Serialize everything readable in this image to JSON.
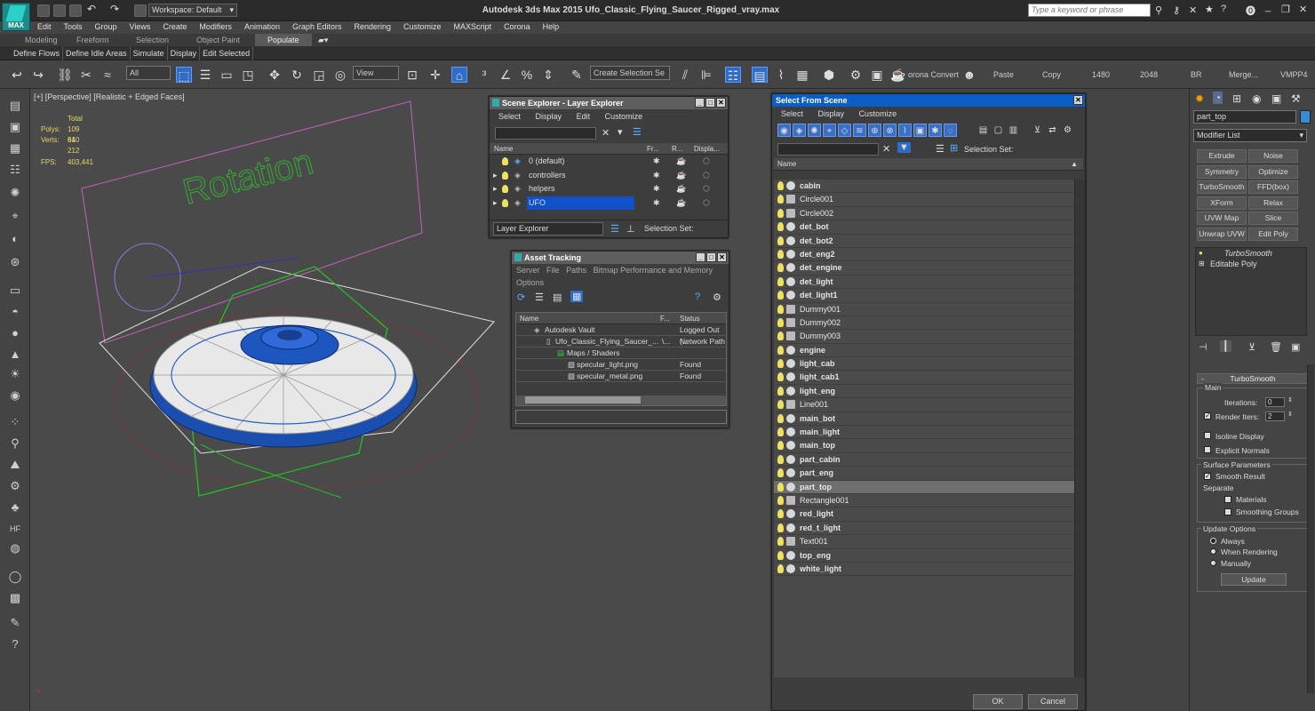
{
  "titlebar": {
    "logo_text": "MAX",
    "workspace_label": "Workspace: Default",
    "app_title": "Autodesk 3ds Max  2015    Ufo_Classic_Flying_Saucer_Rigged_vray.max",
    "search_placeholder": "Type a keyword or phrase"
  },
  "menus": [
    "Edit",
    "Tools",
    "Group",
    "Views",
    "Create",
    "Modifiers",
    "Animation",
    "Graph Editors",
    "Rendering",
    "Customize",
    "MAXScript",
    "Corona",
    "Help"
  ],
  "ribbon": {
    "tabs": [
      "Modeling",
      "Freeform",
      "Selection",
      "Object Paint",
      "Populate"
    ],
    "active_tab": "Populate",
    "sub_items": [
      "Define Flows",
      "Define Idle Areas",
      "Simulate",
      "Display",
      "Edit Selected"
    ]
  },
  "toolbar": {
    "filter_value": "All",
    "refcoord_value": "View",
    "selection_set_placeholder": "Create Selection Se",
    "corona_label": "orona Convert",
    "paste_label": "Paste",
    "copy_label": "Copy",
    "width_value": "1480",
    "height_value": "2048",
    "br_label": "BR",
    "merge_label": "Merge...",
    "vmpp_label": "VMPP4"
  },
  "viewport": {
    "label": "[+] [Perspective] [Realistic + Edged Faces]",
    "stats": {
      "total_label": "Total",
      "polys_label": "Polys:",
      "polys_value": "109 840",
      "verts_label": "Verts:",
      "verts_value": "61 212",
      "fps_label": "FPS:",
      "fps_value": "403,441"
    },
    "rotation_text": "Rotation",
    "accent_green": "#22c022",
    "accent_blue": "#1a5fd0"
  },
  "scene_explorer": {
    "title": "Scene Explorer - Layer Explorer",
    "menus": [
      "Select",
      "Display",
      "Edit",
      "Customize"
    ],
    "columns": [
      "Name",
      "Fr...",
      "R...",
      "Displa..."
    ],
    "rows": [
      {
        "name": "0 (default)",
        "expandable": false
      },
      {
        "name": "controllers",
        "expandable": true
      },
      {
        "name": "helpers",
        "expandable": true
      },
      {
        "name": "UFO",
        "expandable": true
      }
    ],
    "footer_dropdown": "Layer Explorer",
    "selection_set_label": "Selection Set:"
  },
  "asset_tracking": {
    "title": "Asset Tracking",
    "menus": [
      "Server",
      "File",
      "Paths",
      "Bitmap Performance and Memory"
    ],
    "menu_options": "Options",
    "columns": [
      "Name",
      "F...",
      "Status"
    ],
    "rows": [
      {
        "name": "Autodesk Vault",
        "f": "",
        "status": "Logged Out (..."
      },
      {
        "name": "Ufo_Classic_Flying_Saucer_...",
        "f": "\\...",
        "status": "Network Path"
      },
      {
        "name": "Maps / Shaders",
        "f": "",
        "status": ""
      },
      {
        "name": "specular_light.png",
        "f": "",
        "status": "Found"
      },
      {
        "name": "specular_metal.png",
        "f": "",
        "status": "Found"
      }
    ]
  },
  "select_from_scene": {
    "title": "Select From Scene",
    "menus": [
      "Select",
      "Display",
      "Customize"
    ],
    "selection_set_label": "Selection Set:",
    "column_name": "Name",
    "items": [
      {
        "name": "cabin",
        "bold": true
      },
      {
        "name": "Circle001",
        "bold": false
      },
      {
        "name": "Circle002",
        "bold": false
      },
      {
        "name": "det_bot",
        "bold": true
      },
      {
        "name": "det_bot2",
        "bold": true
      },
      {
        "name": "det_eng2",
        "bold": true
      },
      {
        "name": "det_engine",
        "bold": true
      },
      {
        "name": "det_light",
        "bold": true
      },
      {
        "name": "det_light1",
        "bold": true
      },
      {
        "name": "Dummy001",
        "bold": false
      },
      {
        "name": "Dummy002",
        "bold": false
      },
      {
        "name": "Dummy003",
        "bold": false
      },
      {
        "name": "engine",
        "bold": true
      },
      {
        "name": "light_cab",
        "bold": true
      },
      {
        "name": "light_cab1",
        "bold": true
      },
      {
        "name": "light_eng",
        "bold": true
      },
      {
        "name": "Line001",
        "bold": false
      },
      {
        "name": "main_bot",
        "bold": true
      },
      {
        "name": "main_light",
        "bold": true
      },
      {
        "name": "main_top",
        "bold": true
      },
      {
        "name": "part_cabin",
        "bold": true
      },
      {
        "name": "part_eng",
        "bold": true
      },
      {
        "name": "part_top",
        "bold": true,
        "selected": true
      },
      {
        "name": "Rectangle001",
        "bold": false
      },
      {
        "name": "red_light",
        "bold": true
      },
      {
        "name": "red_t_light",
        "bold": true
      },
      {
        "name": "Text001",
        "bold": false
      },
      {
        "name": "top_eng",
        "bold": true
      },
      {
        "name": "white_light",
        "bold": true
      }
    ],
    "ok_label": "OK",
    "cancel_label": "Cancel"
  },
  "command_panel": {
    "object_name": "part_top",
    "object_color": "#3a8ad6",
    "modifier_list": "Modifier List",
    "modifier_buttons": [
      "Extrude",
      "Noise",
      "Symmetry",
      "Optimize",
      "TurboSmooth",
      "FFD(box)",
      "XForm",
      "Relax",
      "UVW Map",
      "Slice",
      "Unwrap UVW",
      "Edit Poly"
    ],
    "stack": [
      "TurboSmooth",
      "Editable Poly"
    ],
    "rollout_title": "TurboSmooth",
    "main_label": "Main",
    "iterations_label": "Iterations:",
    "iterations_value": "0",
    "render_iters_label": "Render Iters:",
    "render_iters_value": "2",
    "isoline_label": "Isoline Display",
    "explicit_normals_label": "Explicit Normals",
    "surface_params_label": "Surface Parameters",
    "smooth_result_label": "Smooth Result",
    "separate_label": "Separate",
    "materials_label": "Materials",
    "smoothing_groups_label": "Smoothing Groups",
    "update_options_label": "Update Options",
    "always_label": "Always",
    "when_rendering_label": "When Rendering",
    "manually_label": "Manually",
    "update_button": "Update"
  }
}
